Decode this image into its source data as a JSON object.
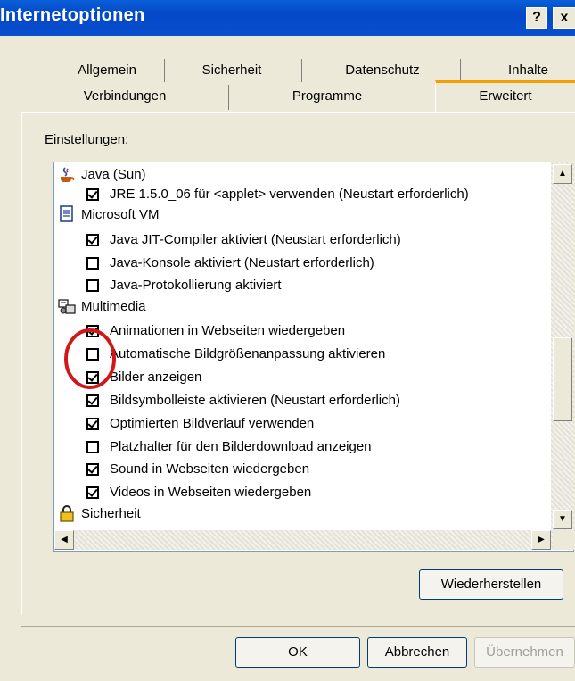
{
  "window": {
    "title": "Internetoptionen",
    "help_label": "?",
    "close_label": "x"
  },
  "tabs_row1": [
    "Allgemein",
    "Sicherheit",
    "Datenschutz",
    "Inhalte"
  ],
  "tabs_row2": [
    "Verbindungen",
    "Programme",
    "Erweitert"
  ],
  "settings_label": "Einstellungen:",
  "settings": [
    {
      "kind": "group",
      "icon": "java-cup-icon",
      "label": "Java (Sun)"
    },
    {
      "kind": "check",
      "checked": true,
      "label": "JRE 1.5.0_06 für <applet> verwenden (Neustart erforderlich)"
    },
    {
      "kind": "group",
      "icon": "document-icon",
      "label": "Microsoft VM"
    },
    {
      "kind": "check",
      "checked": true,
      "label": "Java JIT-Compiler aktiviert (Neustart erforderlich)"
    },
    {
      "kind": "check",
      "checked": false,
      "label": "Java-Konsole aktiviert (Neustart erforderlich)"
    },
    {
      "kind": "check",
      "checked": false,
      "label": "Java-Protokollierung aktiviert"
    },
    {
      "kind": "group",
      "icon": "multimedia-icon",
      "label": "Multimedia"
    },
    {
      "kind": "check",
      "checked": true,
      "label": "Animationen in Webseiten wiedergeben"
    },
    {
      "kind": "check",
      "checked": false,
      "label": "Automatische Bildgrößenanpassung aktivieren"
    },
    {
      "kind": "check",
      "checked": true,
      "label": "Bilder anzeigen"
    },
    {
      "kind": "check",
      "checked": true,
      "label": "Bildsymbolleiste aktivieren (Neustart erforderlich)"
    },
    {
      "kind": "check",
      "checked": true,
      "label": "Optimierten Bildverlauf verwenden"
    },
    {
      "kind": "check",
      "checked": false,
      "label": "Platzhalter für den Bilderdownload anzeigen"
    },
    {
      "kind": "check",
      "checked": true,
      "label": "Sound in Webseiten wiedergeben"
    },
    {
      "kind": "check",
      "checked": true,
      "label": "Videos in Webseiten wiedergeben"
    },
    {
      "kind": "group",
      "icon": "lock-icon",
      "label": "Sicherheit"
    }
  ],
  "buttons": {
    "restore": "Wiederherstellen",
    "ok": "OK",
    "cancel": "Abbrechen",
    "apply": "Übernehmen"
  },
  "colors": {
    "titlebar": "#0a4fd0",
    "highlight_circle": "#d01818",
    "apply_disabled_text": "#a0a09a"
  }
}
